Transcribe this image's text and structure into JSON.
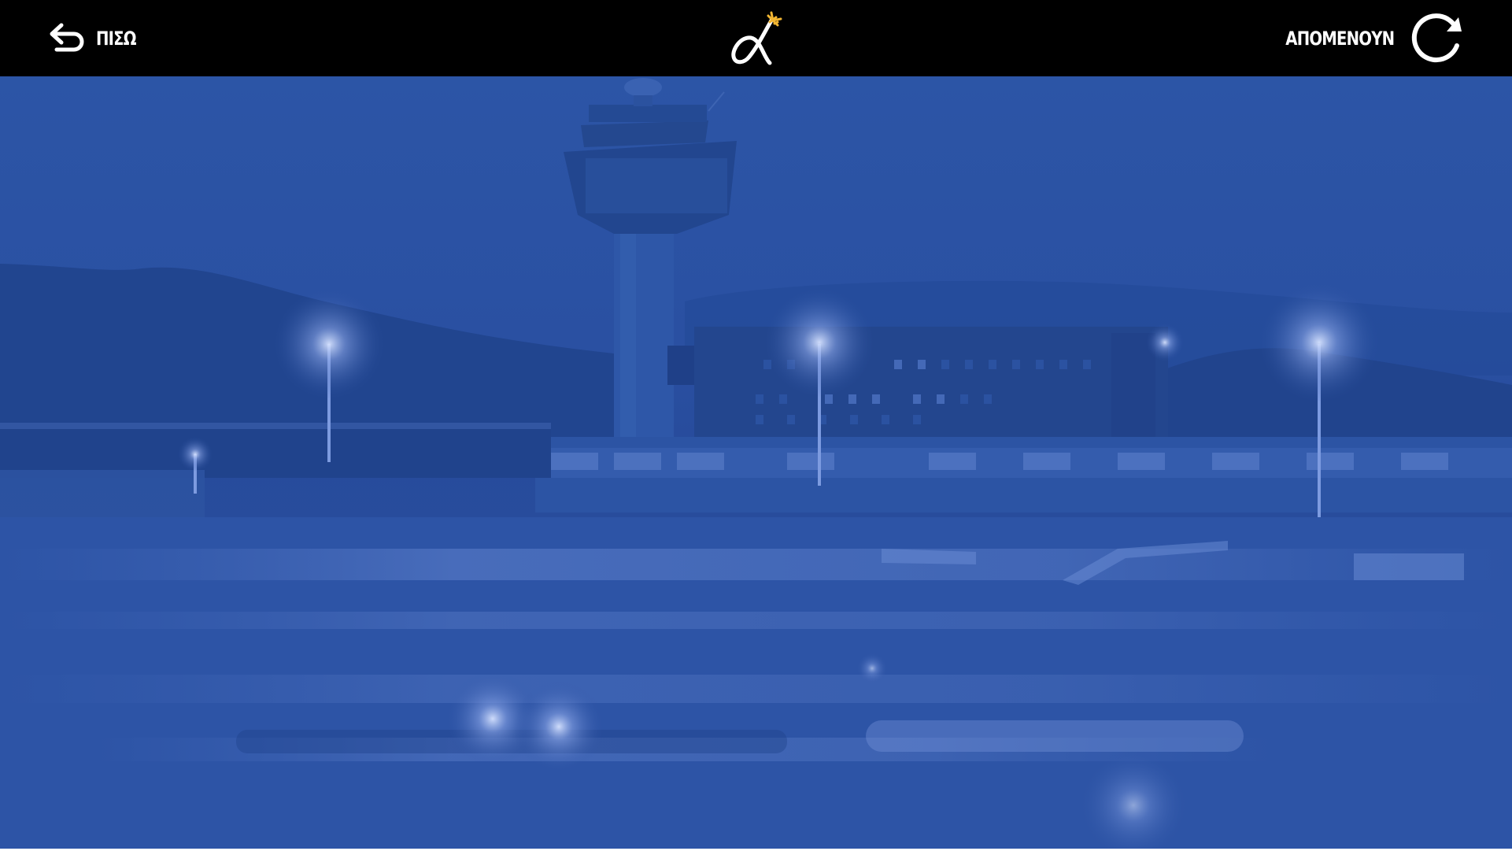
{
  "header": {
    "back_label": "ΠΙΣΩ",
    "next_label": "ΑΠΟΜΕΝΟΥΝ"
  },
  "icons": {
    "back": "back-arrow-icon",
    "logo": "alpha-plane-logo",
    "next": "refresh-icon"
  },
  "colors": {
    "topbar": "#000000",
    "scene_tint": "#2a4fa0",
    "logo_plane": "#f2b632",
    "text": "#ffffff"
  }
}
